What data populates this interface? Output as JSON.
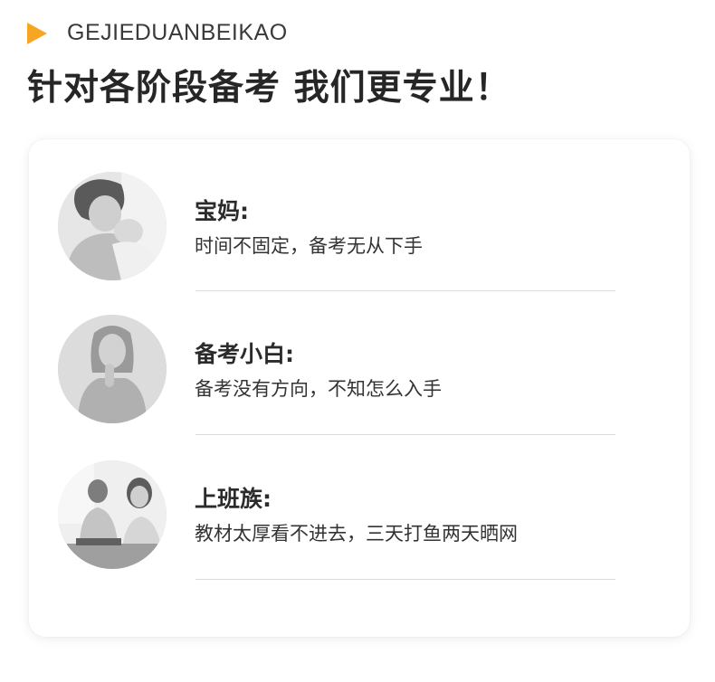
{
  "header": {
    "tag_text": "GEJIEDUANBEIKAO",
    "title": "针对各阶段备考 我们更专业！"
  },
  "colors": {
    "accent": "#f6a623",
    "text_dark": "#262626",
    "divider": "#dcdcdc"
  },
  "icons": {
    "header_marker": "play-triangle-icon"
  },
  "personas": [
    {
      "title": "宝妈:",
      "description": "时间不固定，备考无从下手",
      "avatar": "mother-with-baby-photo"
    },
    {
      "title": "备考小白:",
      "description": "备考没有方向，不知怎么入手",
      "avatar": "thinking-woman-photo"
    },
    {
      "title": "上班族:",
      "description": "教材太厚看不进去，三天打鱼两天晒网",
      "avatar": "office-workers-photo"
    }
  ]
}
